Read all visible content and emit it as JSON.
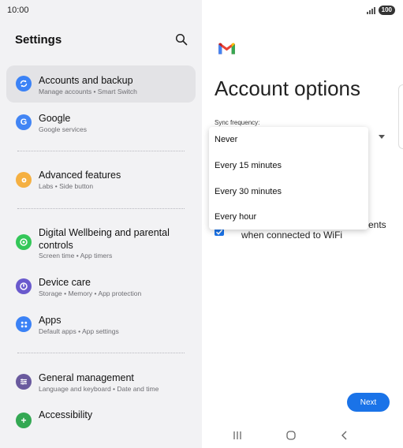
{
  "status_bar": {
    "time": "10:00",
    "battery": "100"
  },
  "settings_panel": {
    "title": "Settings",
    "items": [
      {
        "title": "Accounts and backup",
        "subtitle": "Manage accounts  •  Smart Switch",
        "icon": "sync-icon",
        "color": "#3b82f6",
        "selected": true
      },
      {
        "title": "Google",
        "subtitle": "Google services",
        "icon": "google-g-icon",
        "color": "#4285f4"
      },
      {
        "title": "Advanced features",
        "subtitle": "Labs  •  Side button",
        "icon": "advanced-gear-icon",
        "color": "#f5b041"
      },
      {
        "title": "Digital Wellbeing and parental controls",
        "subtitle": "Screen time  •  App timers",
        "icon": "wellbeing-icon",
        "color": "#34c759"
      },
      {
        "title": "Device care",
        "subtitle": "Storage  •  Memory  •  App protection",
        "icon": "device-care-icon",
        "color": "#6a5acd"
      },
      {
        "title": "Apps",
        "subtitle": "Default apps  •  App settings",
        "icon": "apps-grid-icon",
        "color": "#3b82f6"
      },
      {
        "title": "General management",
        "subtitle": "Language and keyboard  •  Date and time",
        "icon": "sliders-icon",
        "color": "#6a5a9e"
      },
      {
        "title": "Accessibility",
        "subtitle": "",
        "icon": "accessibility-icon",
        "color": "#34a853"
      }
    ]
  },
  "account_panel": {
    "title": "Account options",
    "sync_label": "Sync frequency:",
    "sync_options": [
      "Never",
      "Every 15 minutes",
      "Every 30 minutes",
      "Every hour"
    ],
    "checkbox_text_line1": "ents",
    "checkbox_text_line2": "when connected to WiFi",
    "next_label": "Next"
  },
  "colors": {
    "accent": "#1a73e8",
    "panel_bg": "#f2f2f4"
  }
}
